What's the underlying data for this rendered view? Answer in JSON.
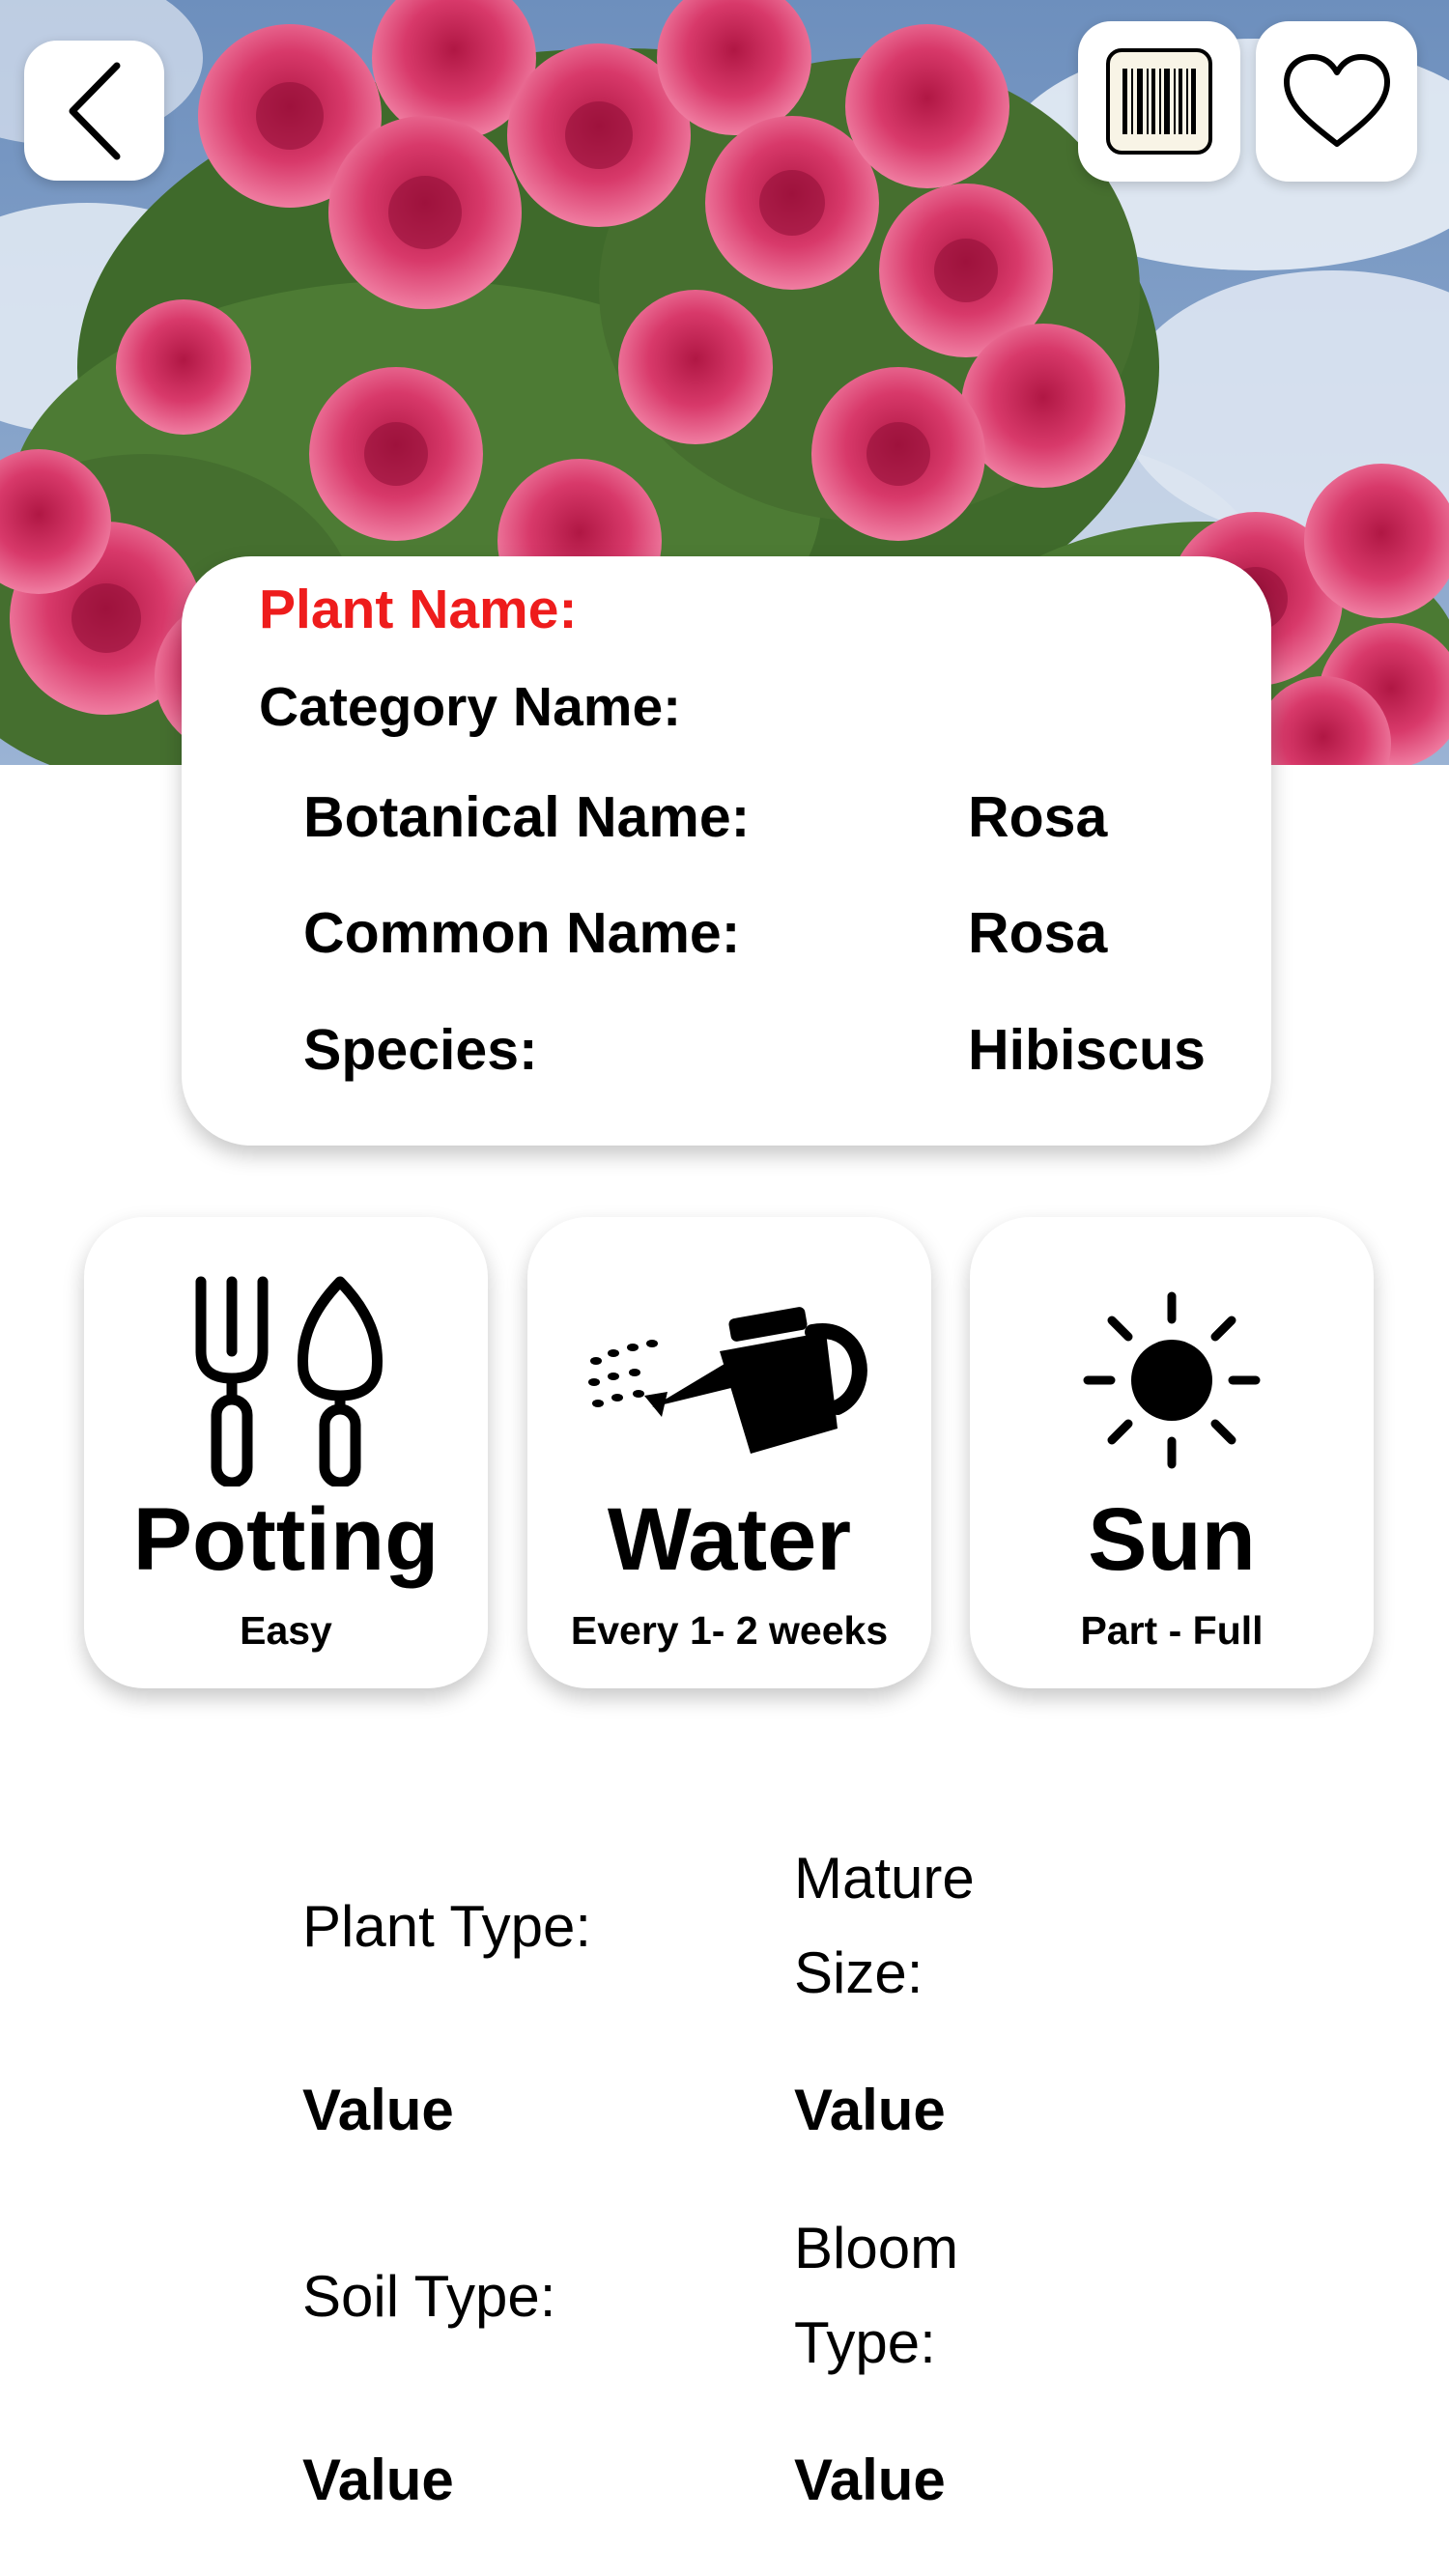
{
  "header": {
    "back_icon": "chevron-left-icon",
    "barcode_icon": "barcode-icon",
    "favorite_icon": "heart-outline-icon"
  },
  "info": {
    "plant_name_label": "Plant Name:",
    "category_name_label": "Category Name:",
    "rows": [
      {
        "label": "Botanical Name:",
        "value": "Rosa"
      },
      {
        "label": "Common Name:",
        "value": "Rosa"
      },
      {
        "label": "Species:",
        "value": "Hibiscus"
      }
    ]
  },
  "care": [
    {
      "title": "Potting",
      "value": "Easy",
      "icon": "garden-tools-icon"
    },
    {
      "title": "Water",
      "value": "Every 1- 2 weeks",
      "icon": "watering-can-icon"
    },
    {
      "title": "Sun",
      "value": "Part - Full",
      "icon": "sun-icon"
    }
  ],
  "details": {
    "plant_type_label": "Plant Type:",
    "plant_type_value": "Value",
    "mature_size_label_line1": "Mature",
    "mature_size_label_line2": "Size:",
    "mature_size_value": "Value",
    "soil_type_label": "Soil Type:",
    "soil_type_value": "Value",
    "bloom_type_label_line1": "Bloom",
    "bloom_type_label_line2": "Type:",
    "bloom_type_value": "Value"
  },
  "colors": {
    "accent_red": "#ee1c1c",
    "card_bg": "#ffffff"
  }
}
